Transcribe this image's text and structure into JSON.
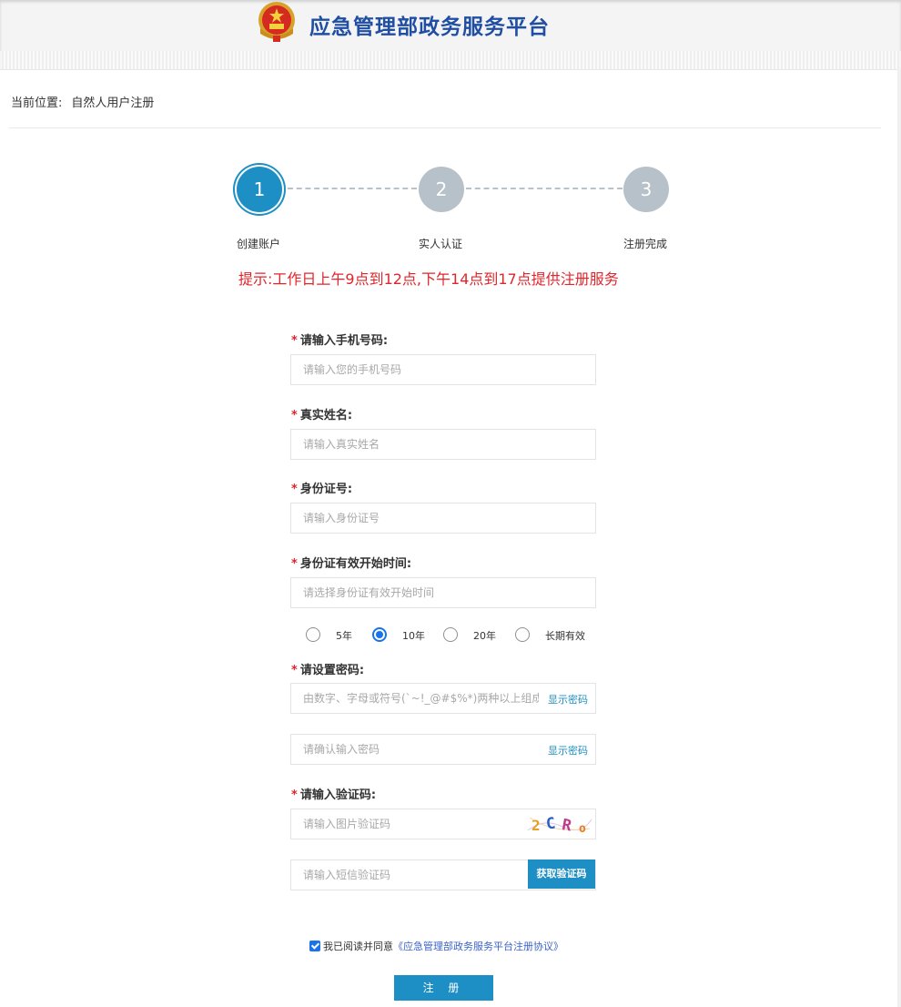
{
  "header": {
    "title": "应急管理部政务服务平台"
  },
  "breadcrumb": {
    "prefix": "当前位置:",
    "current": "自然人用户注册"
  },
  "steps": [
    {
      "number": "1",
      "label": "创建账户",
      "state": "active"
    },
    {
      "number": "2",
      "label": "实人认证",
      "state": "inactive"
    },
    {
      "number": "3",
      "label": "注册完成",
      "state": "inactive"
    }
  ],
  "notice": "提示:工作日上午9点到12点,下午14点到17点提供注册服务",
  "form": {
    "required_mark": "*",
    "phone": {
      "label": "请输入手机号码:",
      "placeholder": "请输入您的手机号码"
    },
    "name": {
      "label": "真实姓名:",
      "placeholder": "请输入真实姓名"
    },
    "idcard": {
      "label": "身份证号:",
      "placeholder": "请输入身份证号"
    },
    "id_start": {
      "label": "身份证有效开始时间:",
      "placeholder": "请选择身份证有效开始时间"
    },
    "validity_options": [
      {
        "label": "5年",
        "checked": false
      },
      {
        "label": "10年",
        "checked": true
      },
      {
        "label": "20年",
        "checked": false
      },
      {
        "label": "长期有效",
        "checked": false
      }
    ],
    "password": {
      "label": "请设置密码:",
      "placeholder": "由数字、字母或符号(`~!_@#$%*)两种以上组成",
      "show_label": "显示密码"
    },
    "confirm_password": {
      "placeholder": "请确认输入密码",
      "show_label": "显示密码"
    },
    "captcha": {
      "label": "请输入验证码:",
      "placeholder": "请输入图片验证码",
      "image_text": "2CRo"
    },
    "sms": {
      "placeholder": "请输入短信验证码",
      "button": "获取验证码"
    },
    "agreement": {
      "prefix": "我已阅读并同意",
      "link": "《应急管理部政务服务平台注册协议》",
      "checked": true
    },
    "submit": "注 册"
  },
  "colors": {
    "primary": "#1e8fc4",
    "title": "#1f4ea3",
    "notice": "#e0252b",
    "step_inactive": "#b6c1c9"
  }
}
